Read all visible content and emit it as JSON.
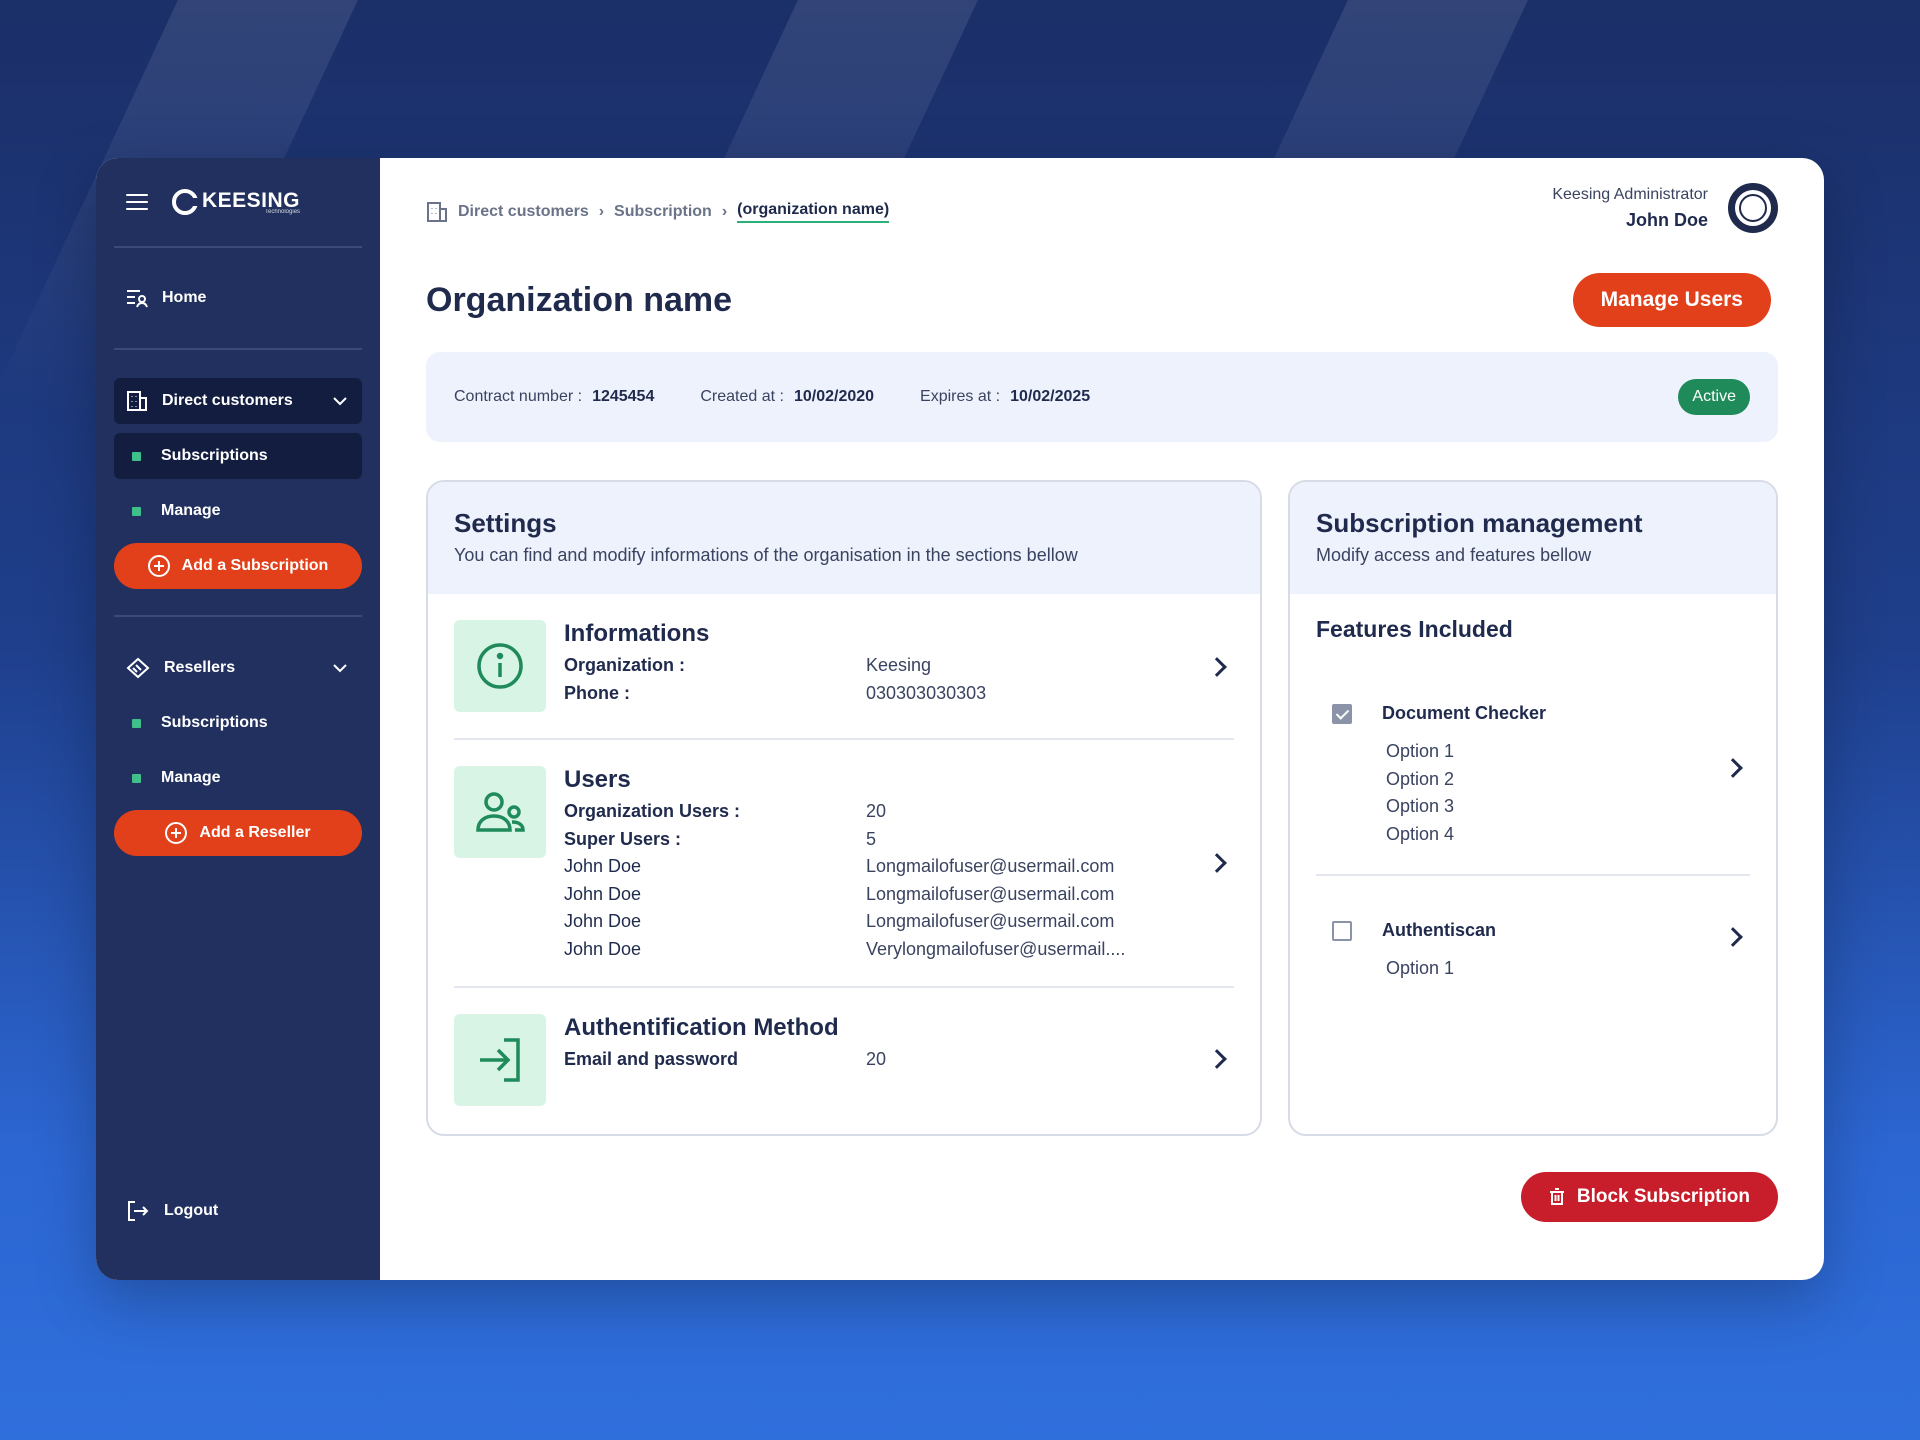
{
  "app": {
    "logo_text": "KEESING",
    "logo_sub": "Technologies"
  },
  "sidebar": {
    "home": "Home",
    "direct_customers": {
      "label": "Direct customers",
      "items": [
        "Subscriptions",
        "Manage"
      ],
      "add_button": "Add a Subscription"
    },
    "resellers": {
      "label": "Resellers",
      "items": [
        "Subscriptions",
        "Manage"
      ],
      "add_button": "Add a Reseller"
    },
    "logout": "Logout"
  },
  "breadcrumb": [
    "Direct customers",
    "Subscription",
    "(organization name)"
  ],
  "user": {
    "role": "Keesing Administrator",
    "name": "John Doe"
  },
  "page": {
    "title": "Organization name",
    "manage_users_button": "Manage Users"
  },
  "contract": {
    "contract_number_label": "Contract number :",
    "contract_number": "1245454",
    "created_label": "Created at :",
    "created": "10/02/2020",
    "expires_label": "Expires at :",
    "expires": "10/02/2025",
    "status": "Active"
  },
  "settings": {
    "title": "Settings",
    "subtitle": "You can find and modify informations of the organisation in the sections bellow",
    "informations": {
      "title": "Informations",
      "org_label": "Organization :",
      "org_value": "Keesing",
      "phone_label": "Phone :",
      "phone_value": "030303030303"
    },
    "users": {
      "title": "Users",
      "org_users_label": "Organization Users :",
      "org_users_value": "20",
      "super_users_label": "Super Users :",
      "super_users_value": "5",
      "list": [
        {
          "name": "John Doe",
          "email": "Longmailofuser@usermail.com"
        },
        {
          "name": "John Doe",
          "email": "Longmailofuser@usermail.com"
        },
        {
          "name": "John Doe",
          "email": "Longmailofuser@usermail.com"
        },
        {
          "name": "John Doe",
          "email": "Verylongmailofuser@usermail...."
        }
      ]
    },
    "auth": {
      "title": "Authentification Method",
      "method_label": "Email and password",
      "method_value": "20"
    }
  },
  "subscription": {
    "title": "Subscription management",
    "subtitle": "Modify access and features bellow",
    "features_title": "Features Included",
    "features": [
      {
        "name": "Document Checker",
        "checked": true,
        "options": [
          "Option 1",
          "Option 2",
          "Option 3",
          "Option 4"
        ]
      },
      {
        "name": "Authentiscan",
        "checked": false,
        "options": [
          "Option 1"
        ]
      }
    ]
  },
  "block_button": "Block Subscription",
  "colors": {
    "sidebar": "#21305f",
    "accent_red": "#e2401a",
    "block_red": "#c81e2b",
    "active_green": "#1f8a5a",
    "icon_green": "#1f8a5a"
  }
}
